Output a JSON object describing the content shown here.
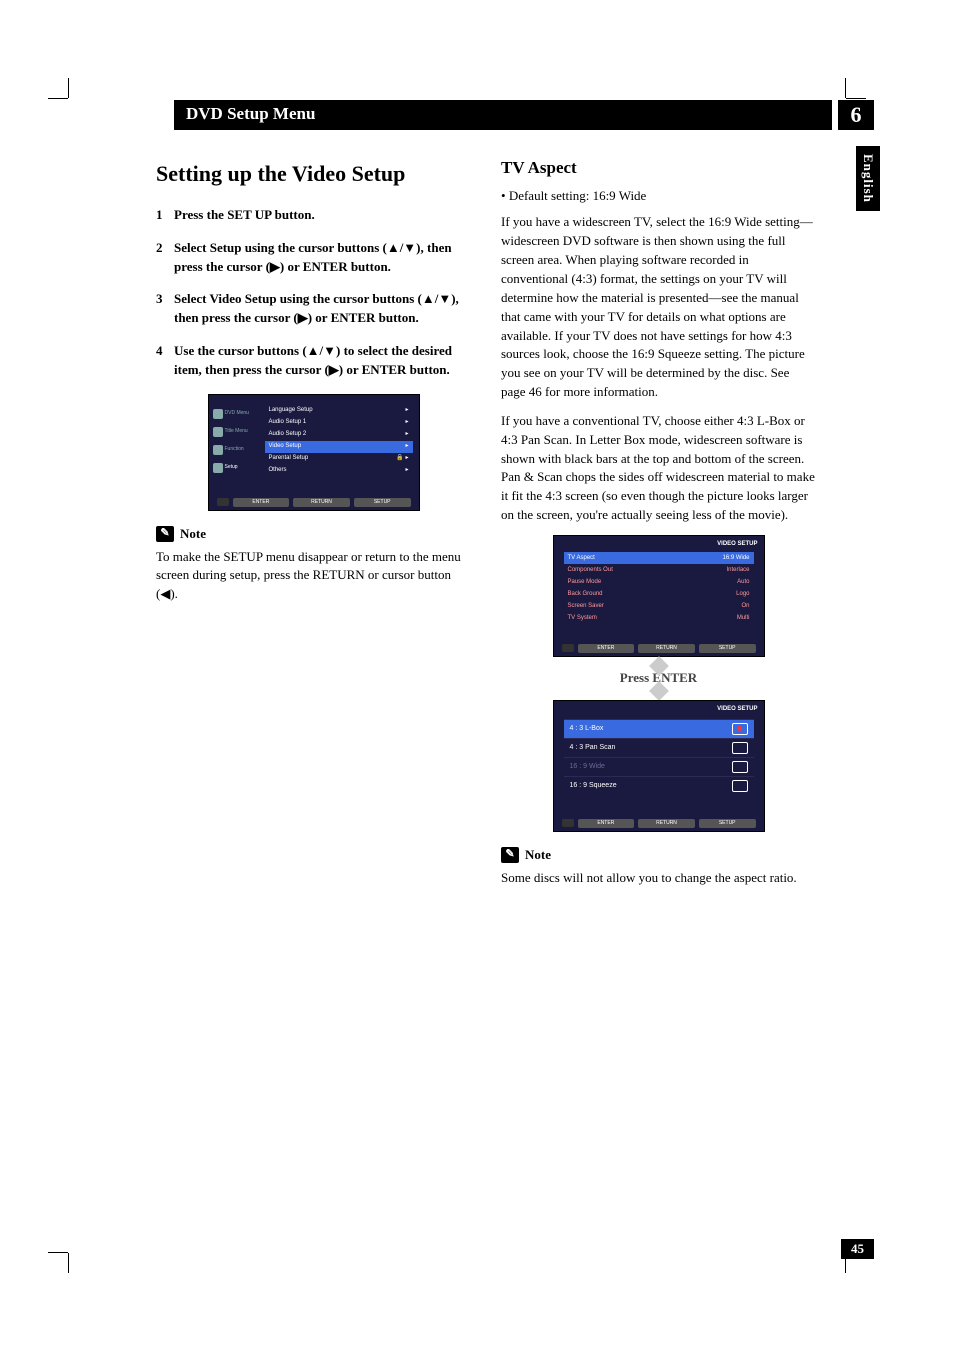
{
  "header": {
    "title": "DVD Setup Menu",
    "chapter": "6"
  },
  "language_tab": "English",
  "page_number": "45",
  "left": {
    "heading": "Setting up the Video Setup",
    "steps": [
      "Press the SET UP button.",
      "Select Setup using the cursor buttons (▲/▼), then press the cursor (▶) or ENTER button.",
      "Select Video Setup using the cursor buttons (▲/▼), then press the cursor (▶) or ENTER button.",
      "Use the cursor buttons (▲/▼) to select the desired item, then press the cursor (▶) or ENTER button."
    ],
    "osd1": {
      "sidebar": [
        "DVD Menu",
        "Title Menu",
        "Function",
        "Setup"
      ],
      "rows": [
        "Language Setup",
        "Audio Setup 1",
        "Audio Setup 2",
        "Video Setup",
        "Parental Setup",
        "Others"
      ],
      "selected_index": 3,
      "footer": [
        "ENTER",
        "RETURN",
        "SETUP"
      ]
    },
    "note_label": "Note",
    "note_text": "To make the SETUP menu disappear or return to the menu screen during setup, press the RETURN or cursor button (◀)."
  },
  "right": {
    "heading": "TV Aspect",
    "default_line": "Default setting: 16:9 Wide",
    "para1": "If you have a widescreen TV, select the 16:9 Wide setting—widescreen DVD software is then shown using the full screen area. When playing software recorded in conventional (4:3) format, the settings on your TV will determine how the material is presented—see the manual that came with your TV for details on what options are available. If your TV does not have settings for how 4:3 sources look, choose the 16:9 Squeeze setting. The picture you see on your TV will be determined by the disc. See page 46 for more information.",
    "para2": "If you have a conventional TV, choose either 4:3 L-Box or 4:3 Pan Scan. In Letter Box mode, widescreen software is shown with black bars at the top and bottom of the screen. Pan & Scan chops the sides off widescreen material to make it fit the 4:3 screen (so even though the picture looks larger on the screen, you're actually seeing less of the movie).",
    "osd2": {
      "header": "VIDEO SETUP",
      "rows": [
        {
          "k": "TV Aspect",
          "v": "16:9 Wide",
          "sel": true
        },
        {
          "k": "Components Out",
          "v": "Interlace"
        },
        {
          "k": "Pause Mode",
          "v": "Auto"
        },
        {
          "k": "Back Ground",
          "v": "Logo"
        },
        {
          "k": "Screen Saver",
          "v": "On"
        },
        {
          "k": "TV System",
          "v": "Multi"
        }
      ],
      "footer": [
        "ENTER",
        "RETURN",
        "SETUP"
      ]
    },
    "press_enter": "Press ENTER",
    "osd3": {
      "header": "VIDEO SETUP",
      "options": [
        {
          "label": "4 : 3 L-Box",
          "on": true,
          "sel": true
        },
        {
          "label": "4 : 3 Pan Scan",
          "on": false
        },
        {
          "label": "16 : 9 Wide",
          "dim": true
        },
        {
          "label": "16 : 9 Squeeze",
          "on": false
        }
      ],
      "footer": [
        "ENTER",
        "RETURN",
        "SETUP"
      ]
    },
    "note_label": "Note",
    "note_text": "Some discs will not allow you to change the aspect ratio."
  }
}
